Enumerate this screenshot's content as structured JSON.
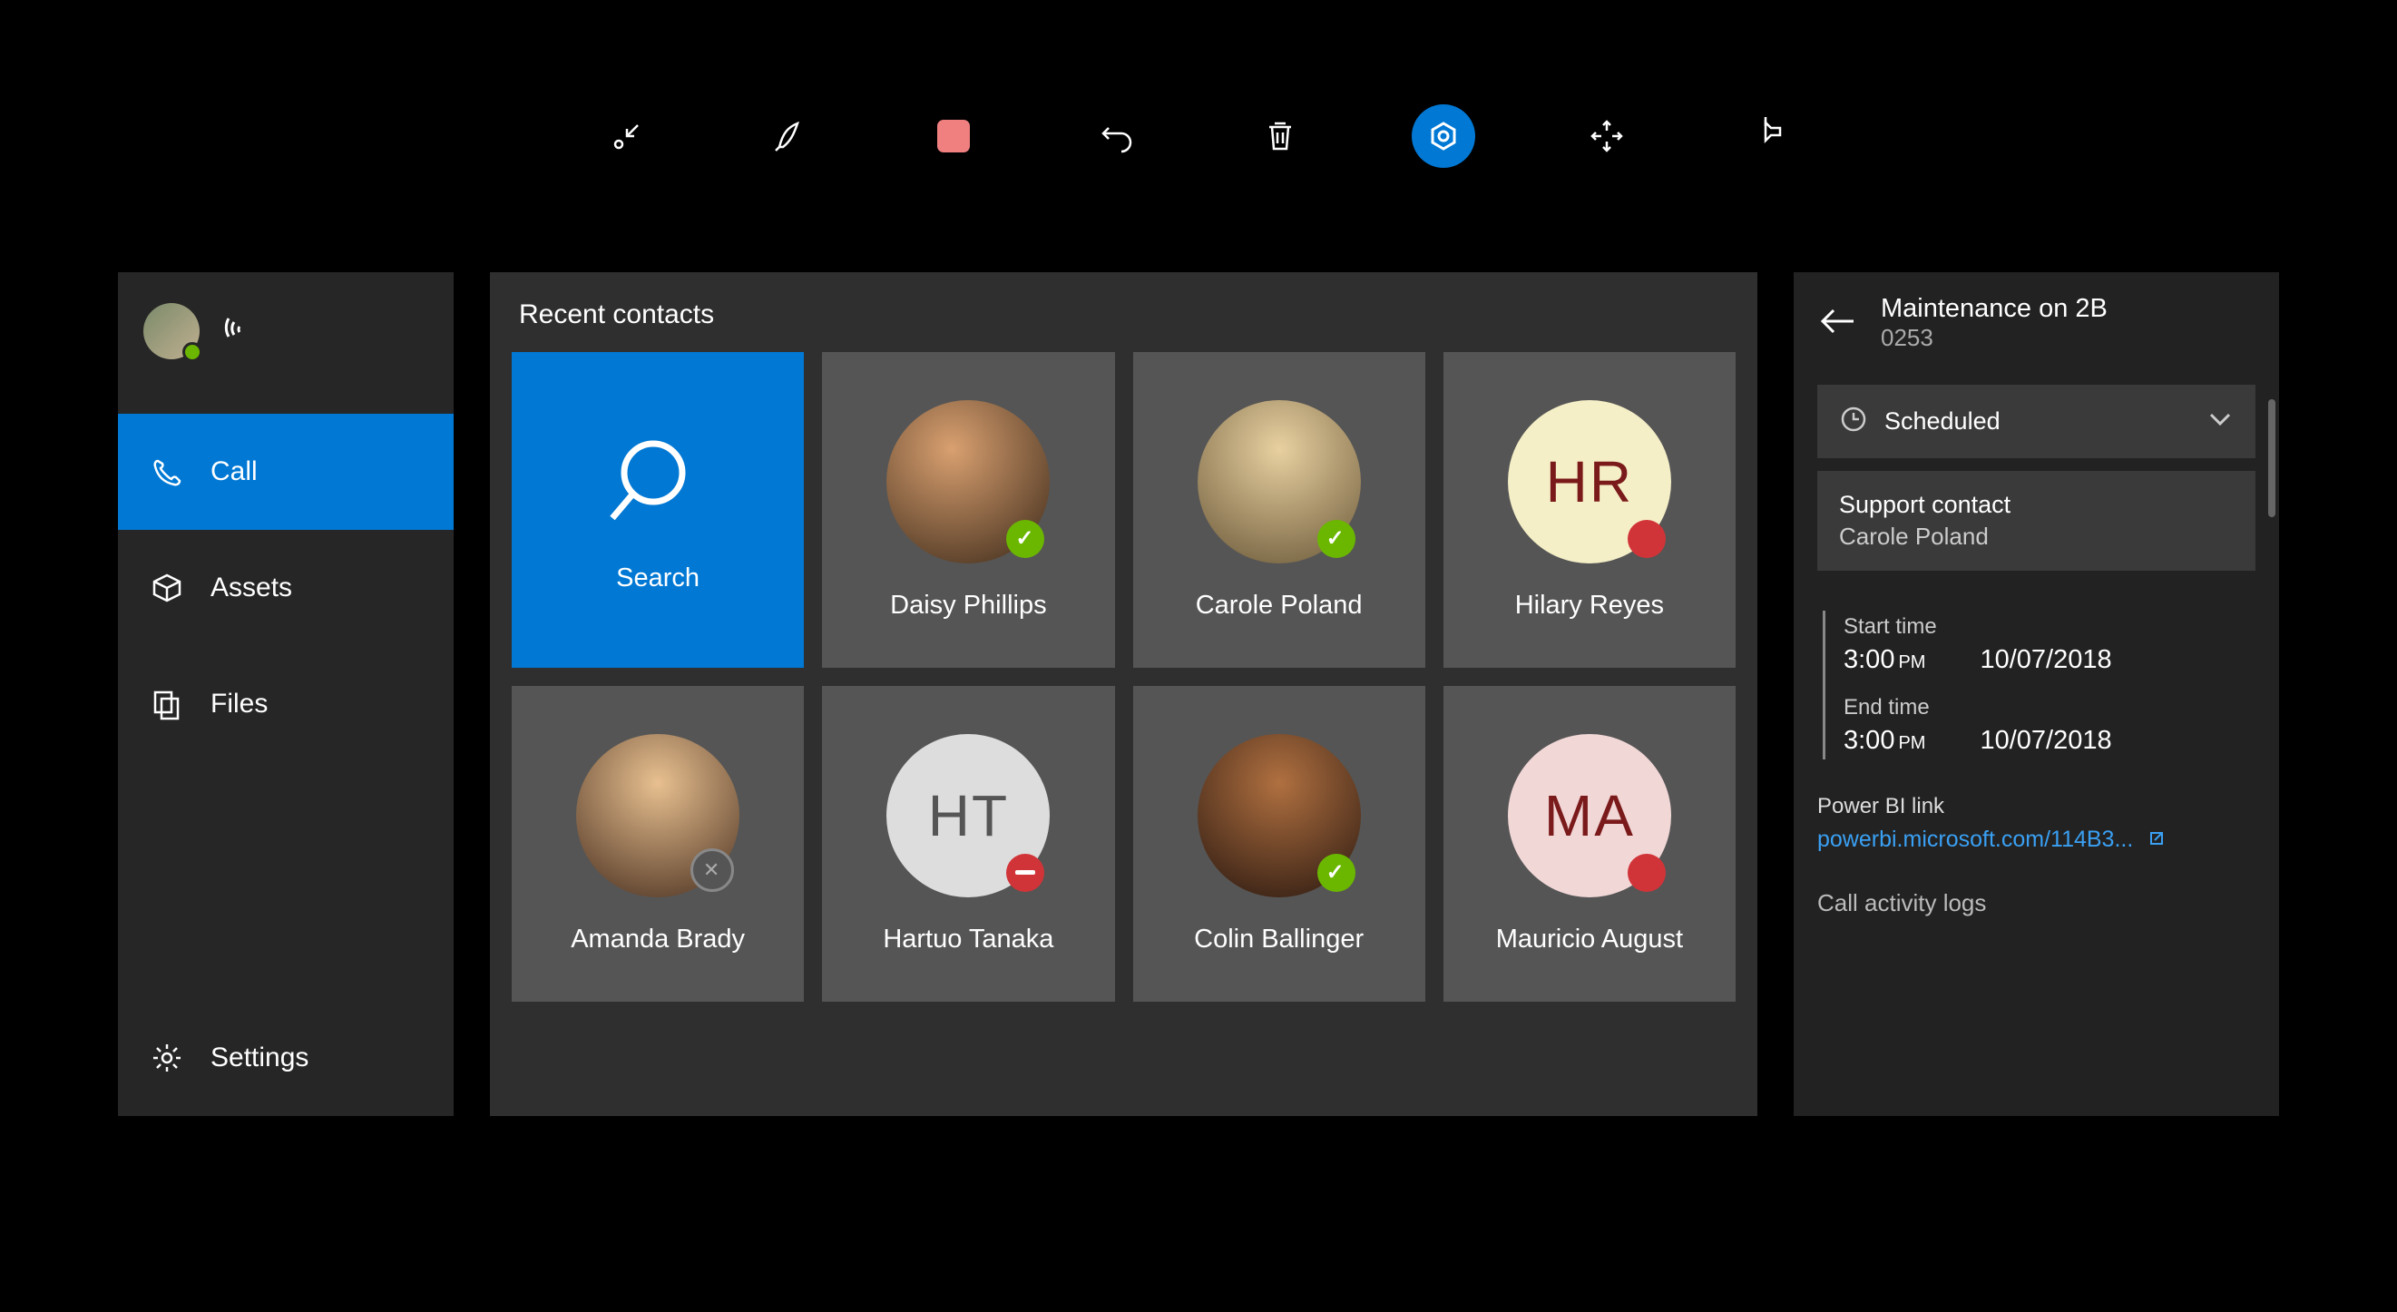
{
  "toolbar": {
    "items": [
      "minimize",
      "draw",
      "stop",
      "undo",
      "delete",
      "shape",
      "move",
      "pin"
    ]
  },
  "sidebar": {
    "call": "Call",
    "assets": "Assets",
    "files": "Files",
    "settings": "Settings"
  },
  "contacts": {
    "heading": "Recent contacts",
    "search": "Search",
    "items": [
      {
        "name": "Daisy Phillips",
        "initials": "",
        "status": "available",
        "photo": "photo1"
      },
      {
        "name": "Carole Poland",
        "initials": "",
        "status": "available",
        "photo": "photo2"
      },
      {
        "name": "Hilary Reyes",
        "initials": "HR",
        "status": "busy",
        "photo": "initials-hr"
      },
      {
        "name": "Amanda Brady",
        "initials": "",
        "status": "offline",
        "photo": "photo3"
      },
      {
        "name": "Hartuo Tanaka",
        "initials": "HT",
        "status": "dnd",
        "photo": "initials-ht"
      },
      {
        "name": "Colin Ballinger",
        "initials": "",
        "status": "available",
        "photo": "photo4"
      },
      {
        "name": "Mauricio August",
        "initials": "MA",
        "status": "busy",
        "photo": "initials-ma"
      }
    ]
  },
  "details": {
    "title": "Maintenance on 2B",
    "id": "0253",
    "status": "Scheduled",
    "support_label": "Support contact",
    "support_name": "Carole Poland",
    "start_label": "Start time",
    "start_time": "3:00",
    "start_pm": "PM",
    "start_date": "10/07/2018",
    "end_label": "End time",
    "end_time": "3:00",
    "end_pm": "PM",
    "end_date": "10/07/2018",
    "link_label": "Power BI link",
    "link_text": "powerbi.microsoft.com/114B3...",
    "logs_label": "Call activity logs"
  }
}
